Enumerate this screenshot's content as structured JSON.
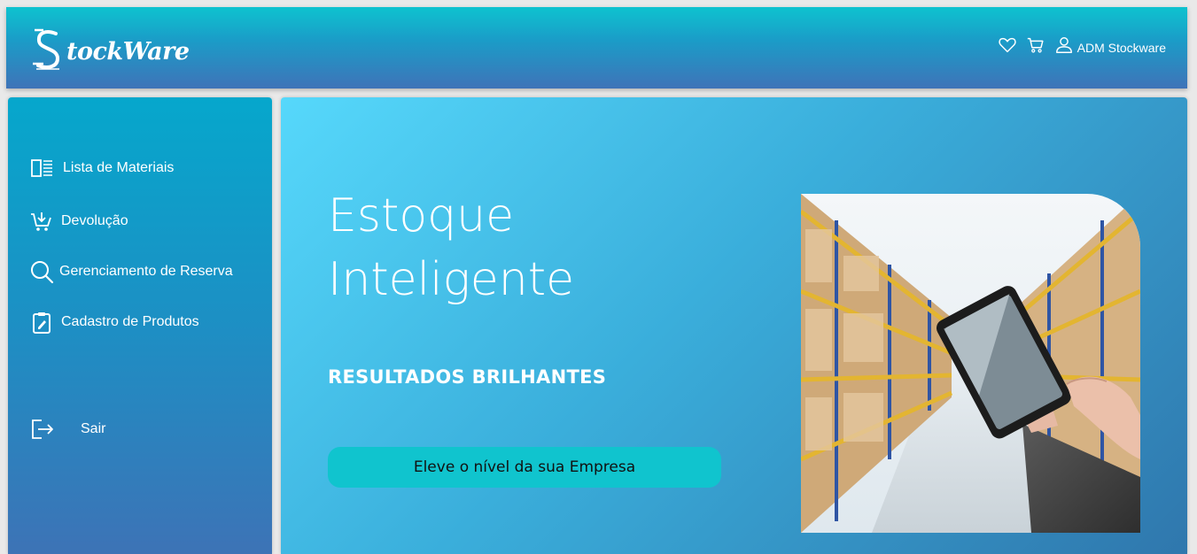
{
  "header": {
    "logo_text": "tockWare",
    "user_name": "ADM Stockware",
    "icons": [
      "heart-icon",
      "cart-icon",
      "user-icon"
    ]
  },
  "sidebar": {
    "items": [
      {
        "label": "Lista de Materiais",
        "icon": "list-icon"
      },
      {
        "label": "Devolução",
        "icon": "cart-return-icon"
      },
      {
        "label": "Gerenciamento de Reserva",
        "icon": "search-icon"
      },
      {
        "label": "Cadastro de Produtos",
        "icon": "clipboard-edit-icon"
      }
    ],
    "logout_label": "Sair"
  },
  "hero": {
    "title": "Estoque Inteligente",
    "subtitle": "RESULTADOS BRILHANTES",
    "button_label": "Eleve o nível da sua Empresa",
    "image": "warehouse-tablet-photo"
  },
  "colors": {
    "accent": "#10c4ce",
    "header_top": "#0ec3cf",
    "header_bottom": "#3f73b8",
    "sidebar_top": "#06a7cc",
    "sidebar_bottom": "#3d73b6",
    "hero_light": "#56d8fb",
    "hero_dark": "#2f77ad"
  }
}
